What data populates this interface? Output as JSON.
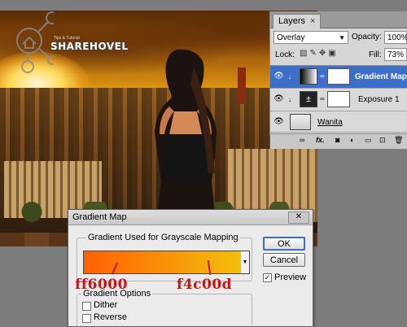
{
  "watermark": {
    "brand": "SHAREHOVEL",
    "tagline": "Tips & Tutorial"
  },
  "layers_panel": {
    "tab": "Layers",
    "tab_close": "×",
    "blend_mode": "Overlay",
    "opacity_label": "Opacity:",
    "opacity_value": "100%",
    "lock_label": "Lock:",
    "fill_label": "Fill:",
    "fill_value": "73%",
    "layers": [
      {
        "name": "Gradient Map",
        "selected": true
      },
      {
        "name": "Exposure 1",
        "selected": false
      },
      {
        "name": "Wanita",
        "selected": false
      }
    ],
    "footer_fx": "fx."
  },
  "dialog": {
    "title": "Gradient Map",
    "close": "✕",
    "group_gradient": "Gradient Used for Grayscale Mapping",
    "gradient_colors": [
      "#ff6000",
      "#f4c00d"
    ],
    "annotations": {
      "left": "ff6000",
      "right": "f4c00d"
    },
    "group_options": "Gradient Options",
    "dither": {
      "label": "Dither",
      "checked": false
    },
    "reverse": {
      "label": "Reverse",
      "checked": false
    },
    "ok": "OK",
    "cancel": "Cancel",
    "preview": {
      "label": "Preview",
      "checked": true
    }
  }
}
